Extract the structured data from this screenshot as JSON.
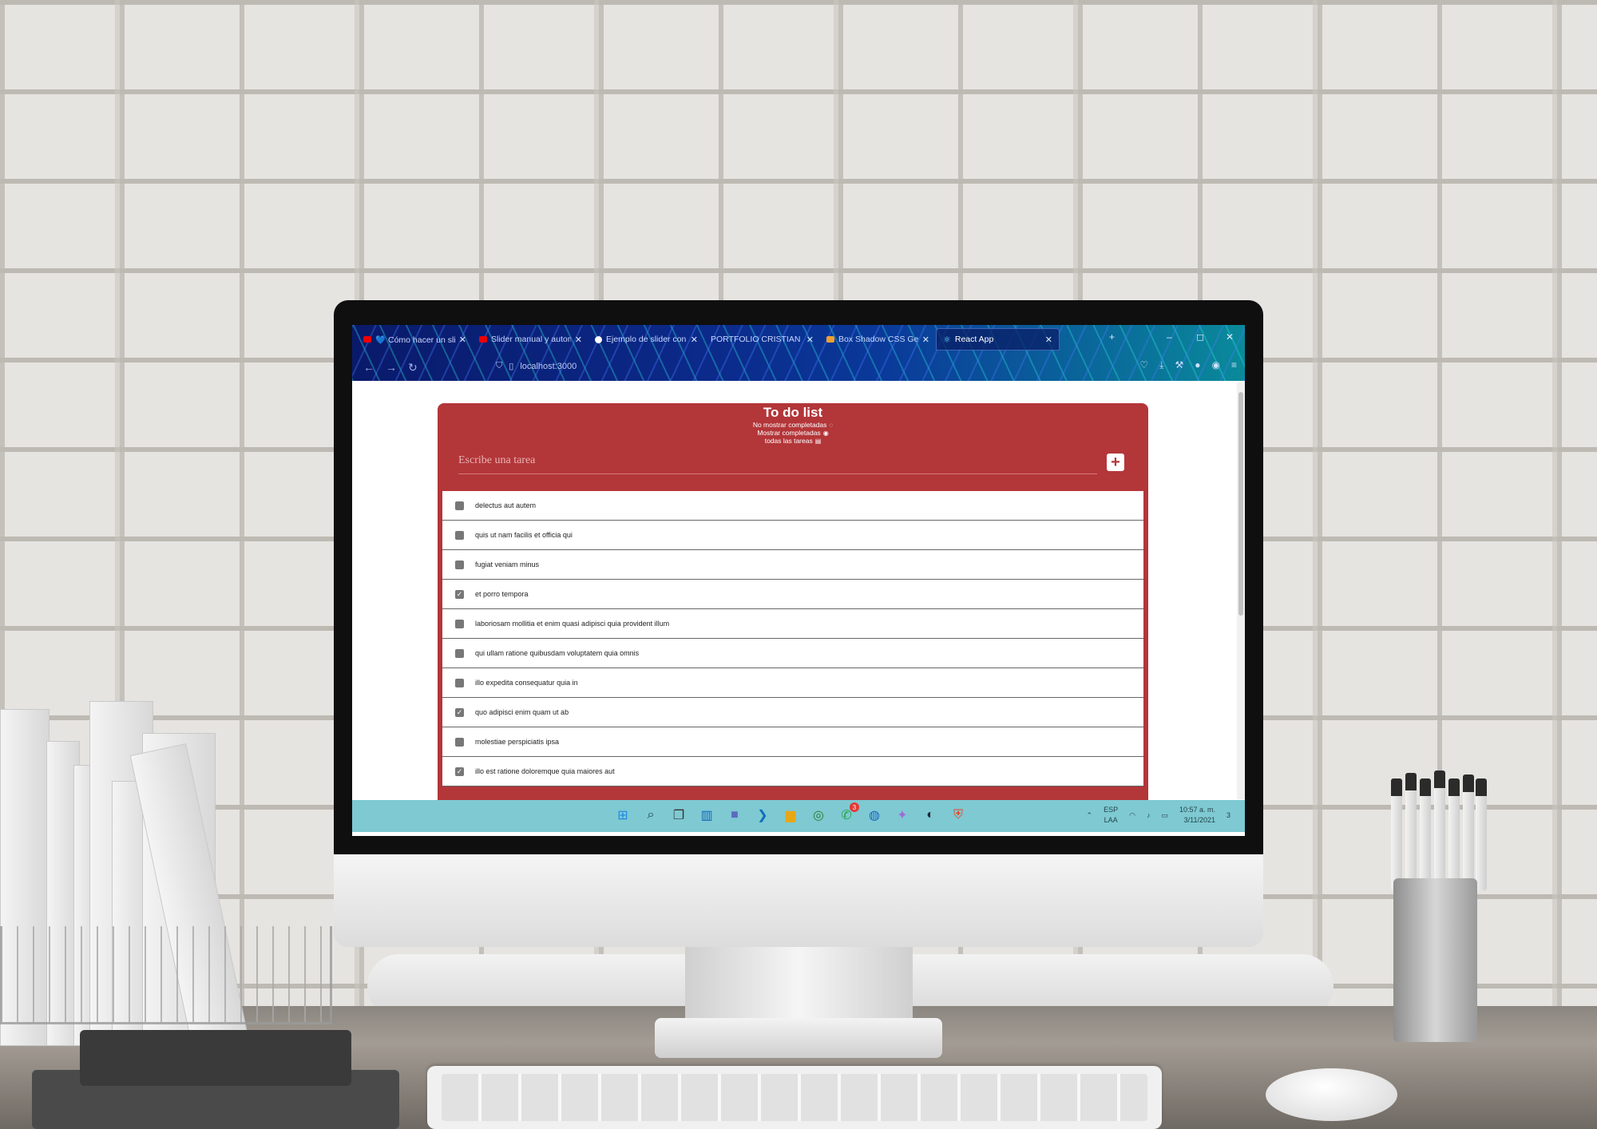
{
  "browser": {
    "tabs": [
      {
        "title": "💙 Cómo hacer un slider",
        "favicon": "youtube-icon",
        "active": false
      },
      {
        "title": "Slider manual y automá",
        "favicon": "youtube-icon",
        "active": false
      },
      {
        "title": "Ejemplo de slider con sc",
        "favicon": "codepen-icon",
        "active": false
      },
      {
        "title": "PORTFOLIO CRISTIAN MOR",
        "favicon": "",
        "active": false
      },
      {
        "title": "Box Shadow CSS Genera",
        "favicon": "box-icon",
        "active": false
      },
      {
        "title": "React App",
        "favicon": "react-icon",
        "active": true
      }
    ],
    "url": "localhost:3000",
    "window_controls": [
      "+",
      "–",
      "◻",
      "✕"
    ]
  },
  "app": {
    "title": "To do list",
    "filters": [
      {
        "label": "No mostrar completadas",
        "icon": "eye-slash-icon"
      },
      {
        "label": "Mostrar completadas",
        "icon": "eye-icon"
      },
      {
        "label": "todas las tareas",
        "icon": "list-icon"
      }
    ],
    "input_placeholder": "Escribe una tarea",
    "add_button_label": "+",
    "tasks": [
      {
        "text": "delectus aut autem",
        "completed": false
      },
      {
        "text": "quis ut nam facilis et officia qui",
        "completed": false
      },
      {
        "text": "fugiat veniam minus",
        "completed": false
      },
      {
        "text": "et porro tempora",
        "completed": true
      },
      {
        "text": "laboriosam mollitia et enim quasi adipisci quia provident illum",
        "completed": false
      },
      {
        "text": "qui ullam ratione quibusdam voluptatem quia omnis",
        "completed": false
      },
      {
        "text": "illo expedita consequatur quia in",
        "completed": false
      },
      {
        "text": "quo adipisci enim quam ut ab",
        "completed": true
      },
      {
        "text": "molestiae perspiciatis ipsa",
        "completed": false
      },
      {
        "text": "illo est ratione doloremque quia maiores aut",
        "completed": true
      }
    ]
  },
  "taskbar": {
    "apps": [
      "windows-start-icon",
      "search-icon",
      "task-view-icon",
      "widgets-icon",
      "teams-icon",
      "vscode-icon",
      "file-explorer-icon",
      "chrome-icon",
      "whatsapp-icon",
      "firefox-icon",
      "figma-icon",
      "steam-icon",
      "brave-icon"
    ],
    "whatsapp_badge": "3",
    "language": "ESP",
    "keyboard": "LAA",
    "time": "10:57 a. m.",
    "date": "3/11/2021",
    "notification_count": "3"
  },
  "colors": {
    "accent": "#b33639",
    "taskbar": "#7ec9d2"
  }
}
